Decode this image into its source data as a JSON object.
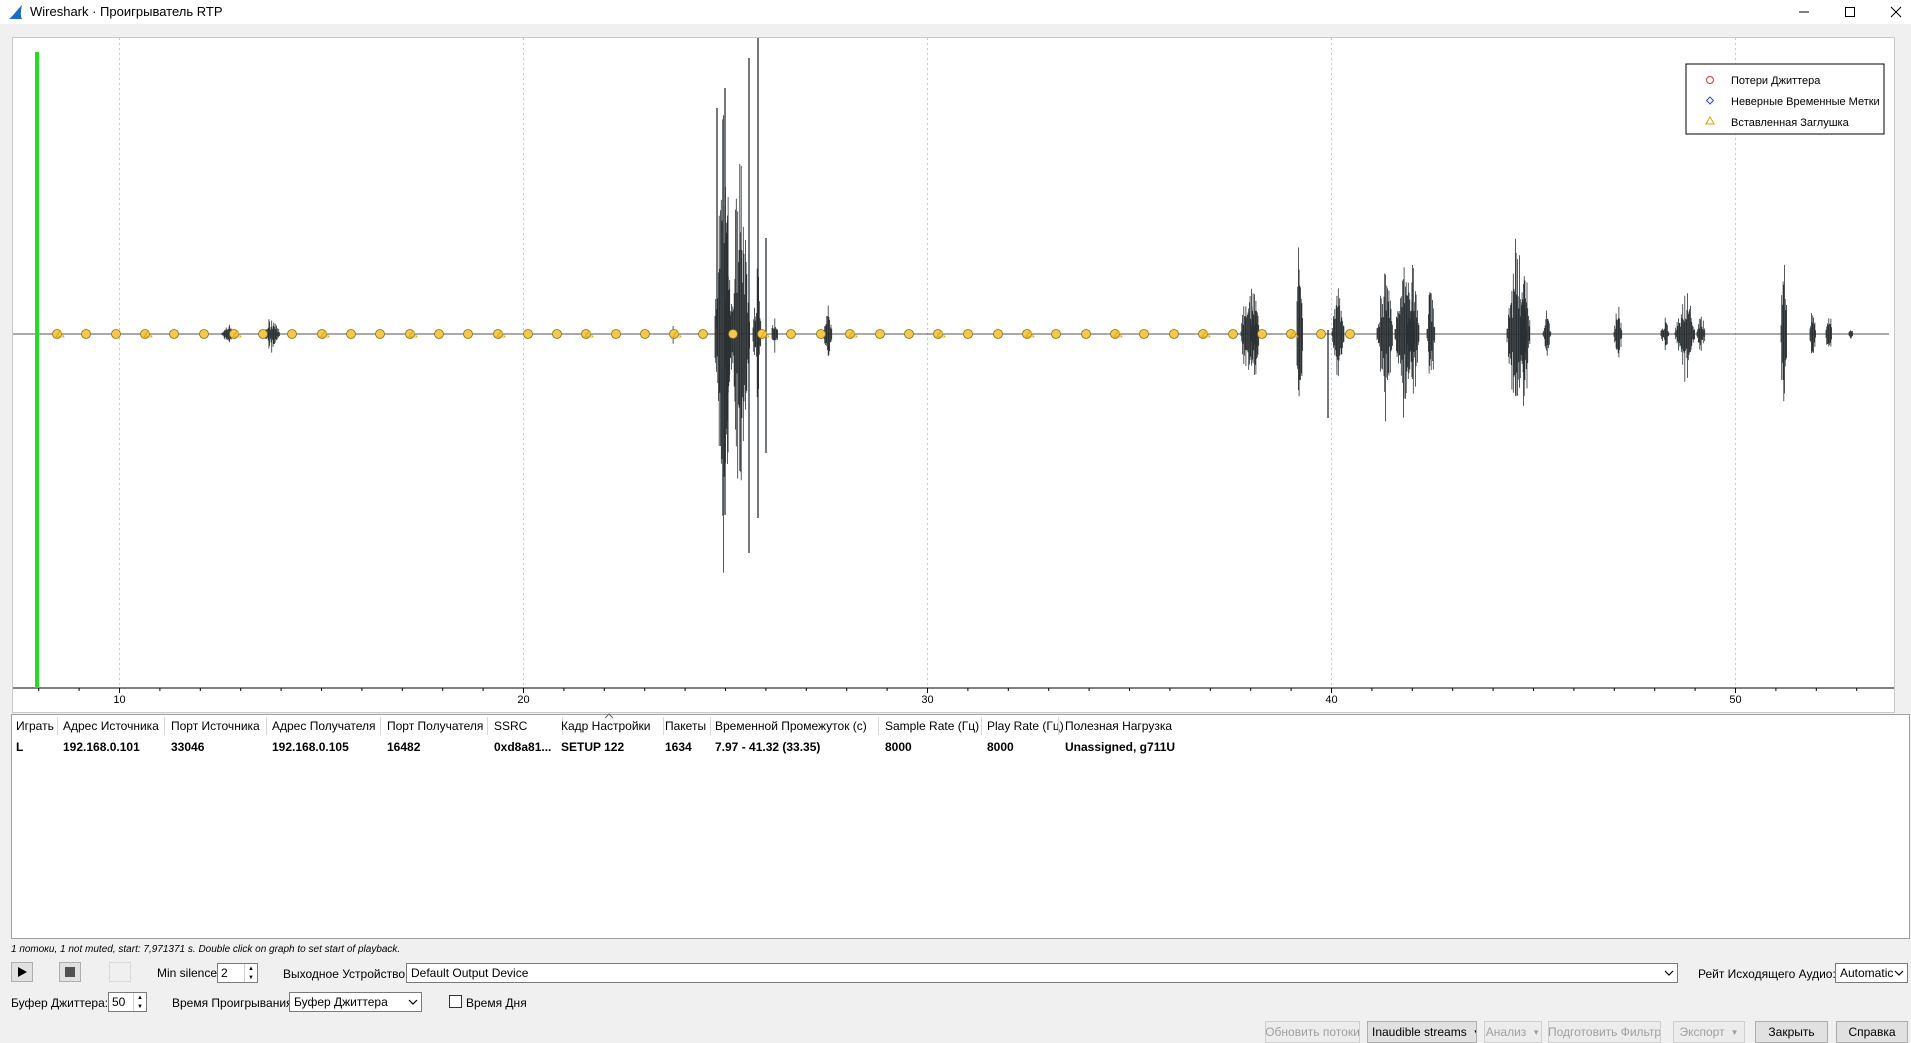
{
  "window": {
    "title": "Wireshark · Проигрыватель RTP"
  },
  "graph": {
    "x_ticks": [
      "10",
      "20",
      "30",
      "40",
      "50"
    ],
    "legend": [
      {
        "label": "Потери Джиттера",
        "color": "#e0302a"
      },
      {
        "label": "Неверные Временные Метки",
        "color": "#2a4fc8"
      },
      {
        "label": "Вставленная Заглушка",
        "color": "#e0a000"
      }
    ],
    "playhead_color": "#22dd22",
    "waveform_color": "#2b3033",
    "marker_fill": "#f2c94c"
  },
  "table": {
    "columns": [
      "Играть",
      "Адрес Источника",
      "Порт Источника",
      "Адрес Получателя",
      "Порт Получателя",
      "SSRC",
      "Кадр Настройки",
      "Пакеты",
      "Временной Промежуток (с)",
      "Sample Rate (Гц)",
      "Play Rate (Гц)",
      "Полезная Нагрузка"
    ],
    "rows": [
      {
        "play": "L",
        "src_addr": "192.168.0.101",
        "src_port": "33046",
        "dst_addr": "192.168.0.105",
        "dst_port": "16482",
        "ssrc": "0xd8a81...",
        "setup_frame": "SETUP 122",
        "packets": "1634",
        "time_span": "7.97 - 41.32 (33.35)",
        "sample_rate": "8000",
        "play_rate": "8000",
        "payload": "Unassigned, g711U"
      }
    ]
  },
  "status": "1 потоки, 1 not muted, start: 7,971371 s. Double click on graph to set start of playback.",
  "controls": {
    "min_silence_label": "Min silence:",
    "min_silence_value": "2",
    "output_device_label": "Выходное Устройство:",
    "output_device_value": "Default Output Device",
    "output_rate_label": "Рейт Исходящего Аудио:",
    "output_rate_value": "Automatic",
    "jitter_buffer_label": "Буфер Джиттера:",
    "jitter_buffer_value": "50",
    "playback_time_label": "Время Проигрывания:",
    "playback_time_value": "Буфер Джиттера",
    "time_of_day_label": "Время Дня"
  },
  "buttons": {
    "refresh_streams": "Обновить потоки",
    "inaudible_streams": "Inaudible streams",
    "analyze": "Анализ",
    "prepare_filter": "Подготовить Фильтр",
    "export": "Экспорт",
    "close": "Закрыть",
    "help": "Справка"
  }
}
